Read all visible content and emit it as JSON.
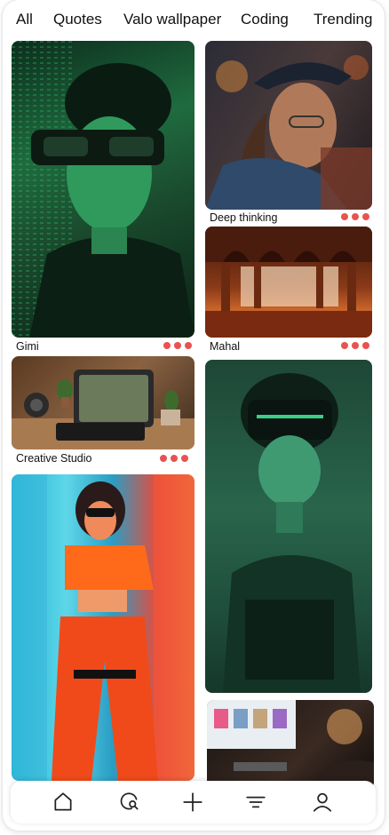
{
  "tabs": [
    {
      "label": "All"
    },
    {
      "label": "Quotes"
    },
    {
      "label": "Valo wallpaper"
    },
    {
      "label": "Coding"
    },
    {
      "label": "Trending"
    }
  ],
  "cards": [
    {
      "caption": "Gimi",
      "image": "green-cyber-woman-sunglasses"
    },
    {
      "caption": "Deep thinking",
      "image": "man-cap-glasses-neon"
    },
    {
      "caption": "Mahal",
      "image": "palace-arches-sunset"
    },
    {
      "caption": "Creative Studio",
      "image": "tablet-desk-camera"
    },
    {
      "caption": "",
      "image": "neon-orange-cyan-woman"
    },
    {
      "caption": "",
      "image": "green-vr-headset-woman"
    },
    {
      "caption": "",
      "image": "dark-desk-monitor"
    }
  ],
  "colors": {
    "dot": "#e8534f",
    "text": "#111111"
  },
  "nav": [
    "home-icon",
    "search-icon",
    "add-icon",
    "filter-icon",
    "profile-icon"
  ]
}
